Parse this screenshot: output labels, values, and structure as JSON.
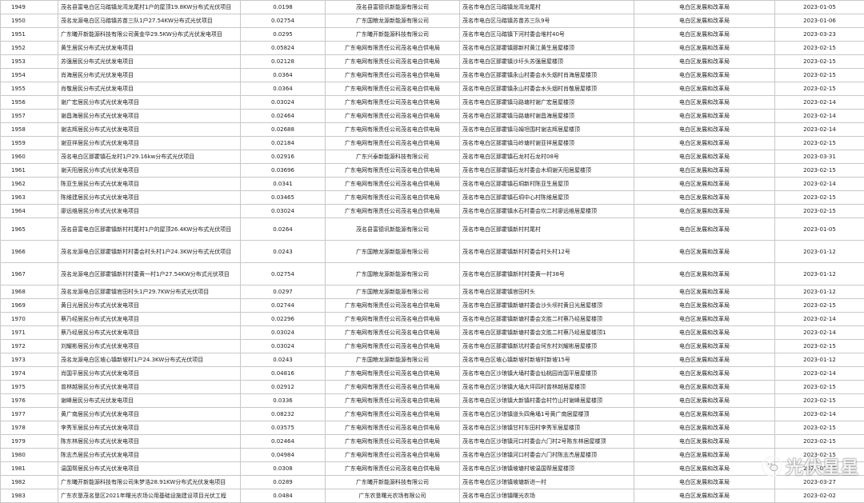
{
  "rows": [
    [
      "1949",
      "茂名县富电白区马踏镇龙湾龙尾村1户的屋顶19.8KW分布式光伏项目",
      "0.0198",
      "茂名县富德讯新能源有限公司",
      "茂名市电白区马踏镇龙湾龙尾村",
      "电白区发展和改革局",
      "2023-01-05"
    ],
    [
      "1950",
      "茂名龙源电白区马踏镇苏苗三队1户27.54KW分布式光伏项目",
      "0.02754",
      "广东国粮龙源新能源有限公司",
      "茂名市电白区马踏镇苏苗苏三队9号",
      "电白区发展和改革局",
      "2023-01-06"
    ],
    [
      "1951",
      "广东曦开新能源科技有限公司黄金华29.5KW分布式光伏发电项目",
      "0.0295",
      "广东曦开新能源科技有限公司",
      "茂名市电白区马踏镇下河村委会堆村40号",
      "电白区发展和改革局",
      "2023-03-23"
    ],
    [
      "1952",
      "黄生居民分布式光伏发电项目",
      "0.05824",
      "广东电网有限责任公司茂名电白供电局",
      "茂名市电白区那霍镇那新村黄江黄生居屋楼顶",
      "电白区发展和改革局",
      "2023-02-15"
    ],
    [
      "1953",
      "苏强居民分布式光伏发电项目",
      "0.02128",
      "广东电网有限责任公司茂名电白供电局",
      "茂名市电白区那霍镇沙圩头苏强居屋楼顶",
      "电白区发展和改革局",
      "2023-02-15"
    ],
    [
      "1954",
      "肖海居民分布式光伏发电项目",
      "0.0364",
      "广东电网有限责任公司茂名电白供电局",
      "茂名市电白区那霍镇永山村委会水头烟村肖海居屋楼顶",
      "电白区发展和改革局",
      "2023-02-15"
    ],
    [
      "1955",
      "肖敬居民分布式光伏发电项目",
      "0.0364",
      "广东电网有限责任公司茂名电白供电局",
      "茂名市电白区那霍镇永山村委会水头烟村肖敬居屋楼顶",
      "电白区发展和改革局",
      "2023-02-15"
    ],
    [
      "1956",
      "谢广宏居民分布式光伏发电项目",
      "0.03024",
      "广东电网有限责任公司茂名电白供电局",
      "茂名市电白区那霍镇马路塘村谢广宏居屋楼顶",
      "电白区发展和改革局",
      "2023-02-14"
    ],
    [
      "1957",
      "谢昌海居民分布式光伏发电项目",
      "0.02464",
      "广东电网有限责任公司茂名电白供电局",
      "茂名市电白区那霍镇马路塘村谢昌海居屋楼顶",
      "电白区发展和改革局",
      "2023-02-14"
    ],
    [
      "1958",
      "谢志辉居民分布式光伏发电项目",
      "0.02688",
      "广东电网有限责任公司茂名电白供电局",
      "茂名市电白区那霍镇马姆坦围村谢志辉居屋楼顶",
      "电白区发展和改革局",
      "2023-02-14"
    ],
    [
      "1959",
      "谢亚祥居民分布式光伏发电项目",
      "0.02184",
      "广东电网有限责任公司茂名电白供电局",
      "茂名市电白区那霍镇马岭塘村谢亚祥居屋楼顶",
      "电白区发展和改革局",
      "2023-02-15"
    ],
    [
      "1960",
      "茂名电白区那霍镇石龙村1户29.16kw分布式光伏项目",
      "0.02916",
      "广东兴泰新能源科技有限公司",
      "茂名市电白区那霍镇石龙村石龙村08号",
      "电白区发展和改革局",
      "2023-03-31"
    ],
    [
      "1961",
      "谢天阳居民分布式光伏发电项目",
      "0.03696",
      "广东电网有限责任公司茂名电白供电局",
      "茂名市电白区那霍镇石龙村委会木垌谢天阳居屋楼顶",
      "电白区发展和改革局",
      "2023-02-15"
    ],
    [
      "1962",
      "陈亚生居民分布式光伏发电项目",
      "0.0341",
      "广东电网有限责任公司茂名电白供电局",
      "茂名市电白区那霍镇石垌新村陈亚生居屋顶",
      "电白区发展和改革局",
      "2023-02-14"
    ],
    [
      "1963",
      "陈维建居民分布式光伏发电项目",
      "0.03465",
      "广东电网有限责任公司茂名电白供电局",
      "茂名市电白区那霍镇石垌中心村陈维居屋顶",
      "电白区发展和改革局",
      "2023-02-15"
    ],
    [
      "1964",
      "廖远维居民分布式光伏发电项目",
      "0.03024",
      "广东电网有限责任公司茂名电白供电局",
      "茂名市电白区那霍镇水石村委会坎二村廖远维居屋楼顶",
      "电白区发展和改革局",
      "2023-02-15"
    ],
    [
      "1965",
      "茂名县富电白区那霍镇新村村尾村1户的屋顶26.4KW分布式光伏项目",
      "0.0264",
      "茂名县富德讯新能源有限公司",
      "茂名市电白区那霍镇新村村尾村",
      "电白区发展和改革局",
      "2023-01-05"
    ],
    [
      "1966",
      "茂名龙源电白区那霍镇新村村委会村头村1户24.3KW分布式光伏项目",
      "0.0243",
      "广东国粮龙源新能源有限公司",
      "茂名市电白区那霍镇新村村委会村头村12号",
      "电白区发展和改革局",
      "2023-01-12"
    ],
    [
      "1967",
      "茂名龙源电白区那霍镇新村村委黄一村1户27.54KW分布式光伏项目",
      "0.02754",
      "广东国粮龙源新能源有限公司",
      "茂名市电白区那霍镇新村村委黄一村38号",
      "电白区发展和改革局",
      "2023-01-12"
    ],
    [
      "1968",
      "茂名龙源电白区那霍镇官田村头1户29.7KW分布式光伏项目",
      "0.0297",
      "广东国粮龙源新能源有限公司",
      "茂名市电白区那霍镇官田村头",
      "电白区发展和改革局",
      "2023-01-12"
    ],
    [
      "1969",
      "黄日光居民分布式光伏发电项目",
      "0.02744",
      "广东电网有限责任公司茂名电白供电局",
      "茂名市电白区那霍镇新塘村委会沙头坝村黄日光居屋楼顶",
      "电白区发展和改革局",
      "2023-02-15"
    ],
    [
      "1970",
      "蔡乃经居民分布式光伏发电项目",
      "0.02296",
      "广东电网有限责任公司茂名电白供电局",
      "茂名市电白区那霍镇新塘村委会文胜二村蔡乃经居屋楼顶",
      "电白区发展和改革局",
      "2023-02-14"
    ],
    [
      "1971",
      "蔡乃经居民分布式光伏发电项目",
      "0.03024",
      "广东电网有限责任公司茂名电白供电局",
      "茂名市电白区那霍镇新塘村委会文胜二村蔡乃经居屋楼顶1",
      "电白区发展和改革局",
      "2023-02-14"
    ],
    [
      "1972",
      "刘耀彬居民分布式光伏发电项目",
      "0.03024",
      "广东电网有限责任公司茂名电白供电局",
      "茂名市电白区那霍镇新坑村委会坷东村刘耀彬居屋楼顶",
      "电白区发展和改革局",
      "2023-02-15"
    ],
    [
      "1973",
      "茂名龙源电白区坡心镇新坡村1户24.3KW分布式光伏项目",
      "0.0243",
      "广东国粮龙源新能源有限公司",
      "茂名市电白区坡心镇新坡村新坡村新坡15号",
      "电白区发展和改革局",
      "2023-01-12"
    ],
    [
      "1974",
      "肖国平居民分布式光伏发电项目",
      "0.04816",
      "广东电网有限责任公司茂名电白供电局",
      "茂名市电白区沙琅镇大埇村委会仙桃园肖国平居屋楼顶",
      "电白区发展和改革局",
      "2023-02-14"
    ],
    [
      "1975",
      "曾林越居民分布式光伏发电项目",
      "0.02912",
      "广东电网有限责任公司茂名电白供电局",
      "茂名市电白区沙琅镇大埇大坪四村曾林越居屋楼顶",
      "电白区发展和改革局",
      "2023-02-15"
    ],
    [
      "1976",
      "谢峰居民分布式光伏发电项目",
      "0.0336",
      "广东电网有限责任公司茂名电白供电局",
      "茂名市电白区沙琅镇大新镇村委会村竹山村谢峰居屋楼顶",
      "电白区发展和改革局",
      "2023-02-15"
    ],
    [
      "1977",
      "黄广南居民分布式光伏发电项目",
      "0.08232",
      "广东电网有限责任公司茂名电白供电局",
      "茂名市电白区沙琅镇道头四角埇1号黄广南居屋楼顶",
      "电白区发展和改革局",
      "2023-02-14"
    ],
    [
      "1978",
      "李秀军居民分布式光伏发电项目",
      "0.03575",
      "广东电网有限责任公司茂名电白供电局",
      "茂名市电白区沙琅镇甘村车田村李秀军居屋楼顶",
      "电白区发展和改革局",
      "2023-02-15"
    ],
    [
      "1979",
      "陈东林居民分布式光伏发电项目",
      "0.02464",
      "广东电网有限责任公司茂名电白供电局",
      "茂名市电白区沙琅镇河口村委会六门村2号陈东林居屋楼顶",
      "电白区发展和改革局",
      "2023-02-15"
    ],
    [
      "1980",
      "陈志杰居民分布式光伏发电项目",
      "0.04984",
      "广东电网有限责任公司茂名电白供电局",
      "茂名市电白区沙琅镇河口村委会六门村陈志杰居屋楼顶",
      "电白区发展和改革局",
      "2023-02-15"
    ],
    [
      "1981",
      "温国帮居民分布式光伏发电项目",
      "0.0308",
      "广东电网有限责任公司茂名电白供电局",
      "茂名市电白区沙琅镇坡塘村坡温国帮居屋楼顶",
      "电白区发展和改革局",
      "2023-02-15"
    ],
    [
      "1982",
      "广东曦开新能源科技有限公司朱梦浩28.91KW分布式光伏发电项目",
      "0.0289",
      "广东曦开新能源科技有限公司",
      "茂名市电白区沙琅镇坡塘新进一村",
      "电白区发展和改革局",
      "2023-03-27"
    ],
    [
      "1983",
      "广东农垦茂名垦区2021年曙光农场公用基础设施建设项目光伏工程",
      "0.0484",
      "广东农垦曙光农场有限公司",
      "茂名市电白区沙琅镇曙光农场",
      "电白区发展和改革局",
      "2023-02-02"
    ]
  ],
  "watermark": {
    "text": "光伏星星",
    "icon": "wechat-logo-icon"
  }
}
